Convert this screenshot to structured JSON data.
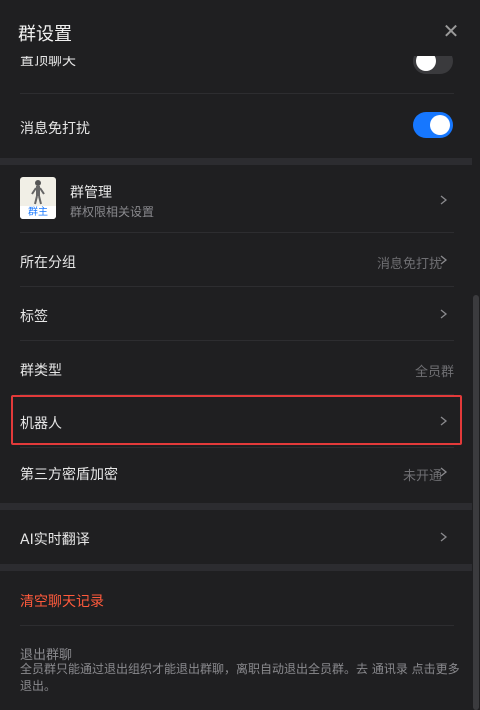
{
  "header": {
    "title": "群设置",
    "close_glyph": "✕"
  },
  "top_partial": {
    "label": "置顶聊天"
  },
  "dnd": {
    "label": "消息免打扰",
    "on": true
  },
  "group_manage": {
    "title": "群管理",
    "subtitle": "群权限相关设置",
    "avatar_tag": "群主"
  },
  "rows": [
    {
      "label": "所在分组",
      "value": "消息免打扰"
    },
    {
      "label": "标签",
      "value": ""
    },
    {
      "label": "群类型",
      "value": "全员群"
    },
    {
      "label": "机器人",
      "value": ""
    },
    {
      "label": "第三方密盾加密",
      "value": "未开通"
    }
  ],
  "ai_translate": {
    "label": "AI实时翻译"
  },
  "clear_history": {
    "label": "清空聊天记录"
  },
  "leave": {
    "title": "退出群聊",
    "desc": "全员群只能通过退出组织才能退出群聊，离职自动退出全员群。去 通讯录 点击更多退出。"
  },
  "colors": {
    "accent": "#1677ff",
    "danger": "#ff5a3c",
    "highlight": "#e33a3a"
  }
}
